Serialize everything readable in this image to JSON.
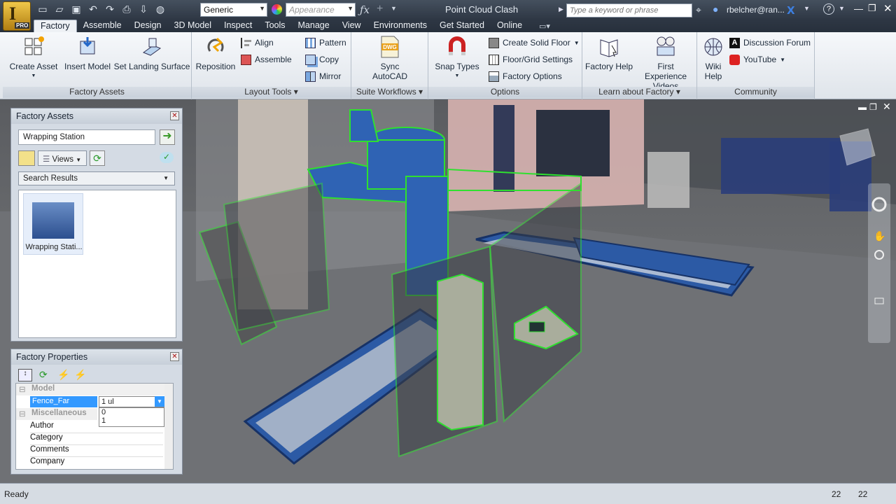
{
  "app": {
    "title": "Point Cloud Clash",
    "app_letter": "I",
    "edition": "PRO"
  },
  "titlebar": {
    "visual_style": "Generic",
    "appearance_placeholder": "Appearance",
    "search_placeholder": "Type a keyword or phrase",
    "username": "rbelcher@ran..."
  },
  "tabs": [
    "Factory",
    "Assemble",
    "Design",
    "3D Model",
    "Inspect",
    "Tools",
    "Manage",
    "View",
    "Environments",
    "Get Started",
    "Online"
  ],
  "ribbon": {
    "factory_assets": {
      "label": "Factory Assets",
      "create_asset": "Create Asset",
      "insert_model": "Insert Model",
      "set_landing_surface": "Set Landing Surface"
    },
    "layout_tools": {
      "label": "Layout Tools",
      "reposition": "Reposition",
      "align": "Align",
      "assemble": "Assemble",
      "pattern": "Pattern",
      "copy": "Copy",
      "mirror": "Mirror"
    },
    "suite_workflows": {
      "label": "Suite Workflows",
      "sync_autocad": "Sync AutoCAD",
      "dwg_badge": "DWG"
    },
    "options": {
      "label": "Options",
      "snap_types": "Snap Types",
      "create_solid_floor": "Create Solid Floor",
      "floor_grid_settings": "Floor/Grid Settings",
      "factory_options": "Factory Options"
    },
    "learn": {
      "label": "Learn about Factory",
      "factory_help": "Factory Help",
      "first_experience_videos": "First Experience Videos"
    },
    "community": {
      "label": "Community",
      "wiki_help": "Wiki Help",
      "discussion_forum": "Discussion Forum",
      "youtube": "YouTube"
    }
  },
  "factory_assets_panel": {
    "title": "Factory Assets",
    "search_value": "Wrapping Station",
    "views_label": "Views",
    "results_dropdown": "Search Results",
    "item_label": "Wrapping Stati..."
  },
  "factory_properties_panel": {
    "title": "Factory Properties",
    "model_category": "Model",
    "fence_far_label": "Fence_Far",
    "fence_far_value": "1 ul",
    "dropdown_options": [
      "0",
      "1"
    ],
    "misc_category": "Miscellaneous",
    "author_label": "Author",
    "category_label": "Category",
    "comments_label": "Comments",
    "company_label": "Company"
  },
  "statusbar": {
    "ready": "Ready",
    "count1": "22",
    "count2": "22"
  }
}
